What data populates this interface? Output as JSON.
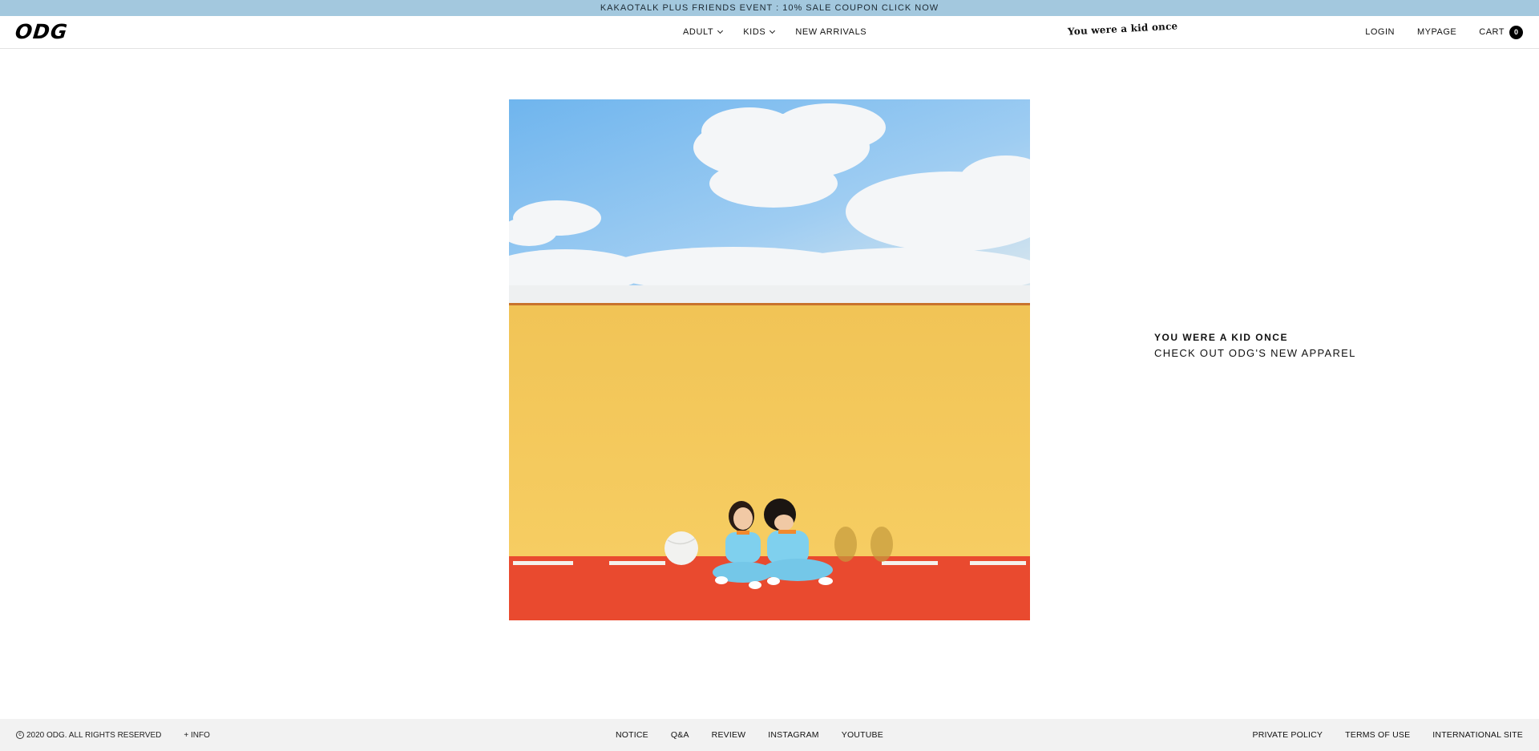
{
  "announcement": {
    "text": "KAKAOTALK PLUS FRIENDS EVENT : 10% SALE COUPON CLICK NOW"
  },
  "header": {
    "logo": "ODG",
    "tagline": "You were a kid once",
    "nav": [
      {
        "label": "ADULT",
        "has_dropdown": true
      },
      {
        "label": "KIDS",
        "has_dropdown": true
      },
      {
        "label": "NEW ARRIVALS",
        "has_dropdown": false
      }
    ],
    "utility": {
      "login": "LOGIN",
      "mypage": "MYPAGE",
      "cart": "CART",
      "cart_count": "0"
    }
  },
  "hero": {
    "colors": {
      "sky": "#7fbef0",
      "cloud": "#f3f5f7",
      "wall_top": "#eef0f1",
      "wall": "#f4c85c",
      "ground": "#e94a2f",
      "outfit": "#7fd0ee"
    }
  },
  "promo": {
    "title": "YOU WERE A KID ONCE",
    "subtitle": "CHECK OUT ODG'S NEW APPAREL"
  },
  "footer": {
    "copyright": "2020 ODG. ALL RIGHTS RESERVED",
    "info": "+ INFO",
    "center_links": [
      "NOTICE",
      "Q&A",
      "REVIEW",
      "INSTAGRAM",
      "YOUTUBE"
    ],
    "right_links": [
      "PRIVATE POLICY",
      "TERMS OF USE",
      "INTERNATIONAL SITE"
    ]
  }
}
